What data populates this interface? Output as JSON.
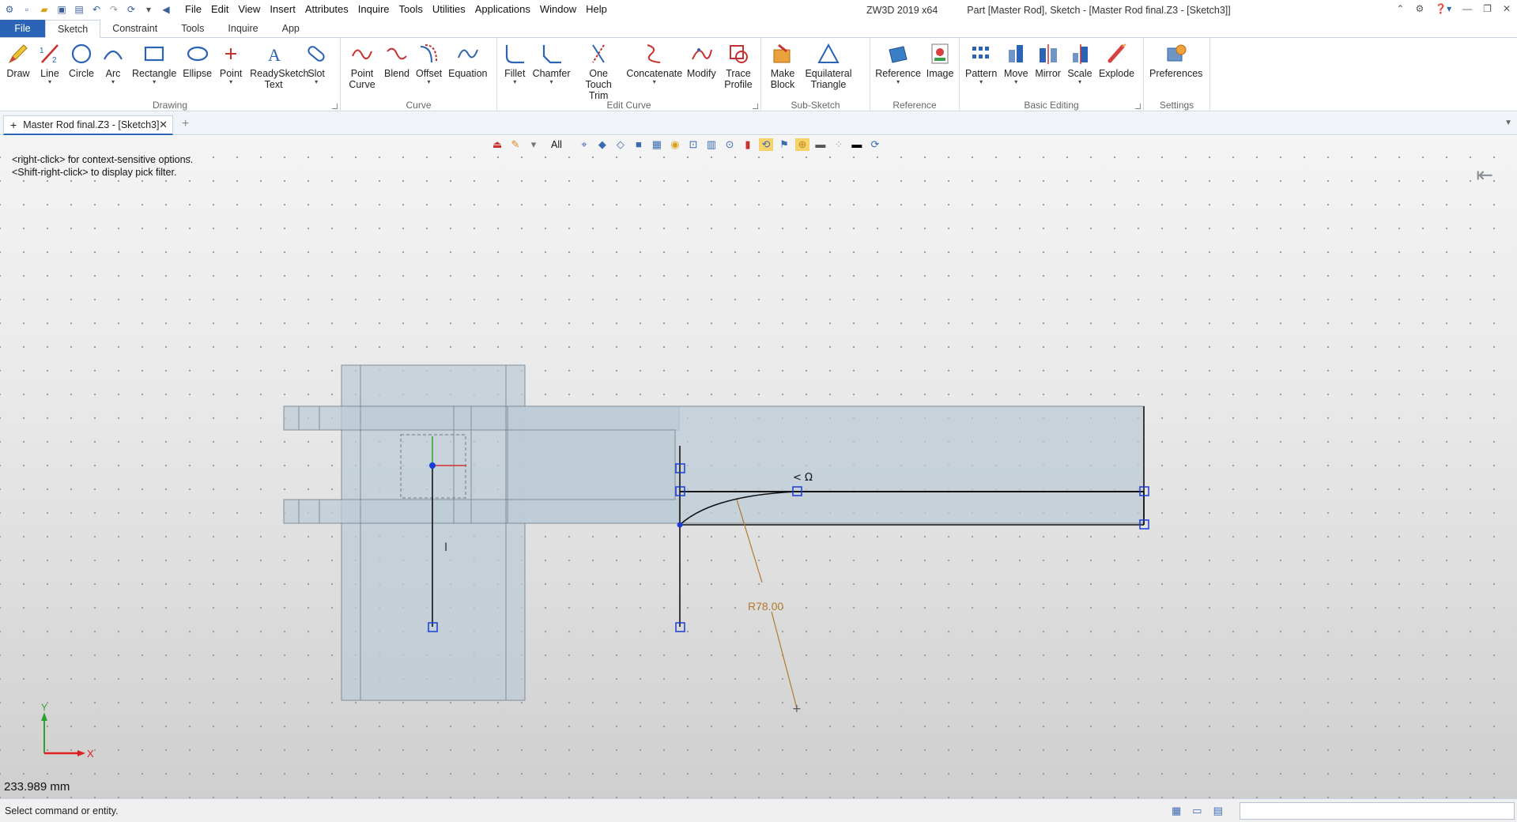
{
  "titlebar": {
    "menu": [
      "File",
      "Edit",
      "View",
      "Insert",
      "Attributes",
      "Inquire",
      "Tools",
      "Utilities",
      "Applications",
      "Window",
      "Help"
    ],
    "app_title": "ZW3D 2019  x64",
    "doc_title": "Part [Master Rod],  Sketch - [Master Rod final.Z3 - [Sketch3]]"
  },
  "ribbon_tabs": [
    "File",
    "Sketch",
    "Constraint",
    "Tools",
    "Inquire",
    "App"
  ],
  "ribbon": {
    "drawing": {
      "label": "Drawing",
      "buttons": [
        "Draw",
        "Line",
        "Circle",
        "Arc",
        "Rectangle",
        "Ellipse",
        "Point",
        "ReadySketch Text",
        "Slot"
      ]
    },
    "curve": {
      "label": "Curve",
      "buttons": [
        "Point Curve",
        "Blend",
        "Offset",
        "Equation"
      ]
    },
    "edit_curve": {
      "label": "Edit Curve",
      "buttons": [
        "Fillet",
        "Chamfer",
        "One Touch Trim",
        "Concatenate",
        "Modify",
        "Trace Profile"
      ]
    },
    "sub_sketch": {
      "label": "Sub-Sketch",
      "buttons": [
        "Make Block",
        "Equilateral Triangle"
      ]
    },
    "reference": {
      "label": "Reference",
      "buttons": [
        "Reference",
        "Image"
      ]
    },
    "basic_editing": {
      "label": "Basic Editing",
      "buttons": [
        "Pattern",
        "Move",
        "Mirror",
        "Scale",
        "Explode"
      ]
    },
    "settings": {
      "label": "Settings",
      "buttons": [
        "Preferences"
      ]
    }
  },
  "doc_tab": {
    "title": "Master Rod final.Z3 - [Sketch3]"
  },
  "viewport": {
    "hint_line1": "<right-click> for context-sensitive options.",
    "hint_line2": "<Shift-right-click> to display pick filter.",
    "filter": "All",
    "dimension": "R78.00",
    "axis_x": "X",
    "axis_y": "Y",
    "readout": "233.989 mm"
  },
  "status": {
    "message": "Select command or entity."
  },
  "colors": {
    "accent": "#2b63b6",
    "dimension": "#b07a2a",
    "handle": "#1a3cd6",
    "part_fill": "#bccbd6"
  }
}
